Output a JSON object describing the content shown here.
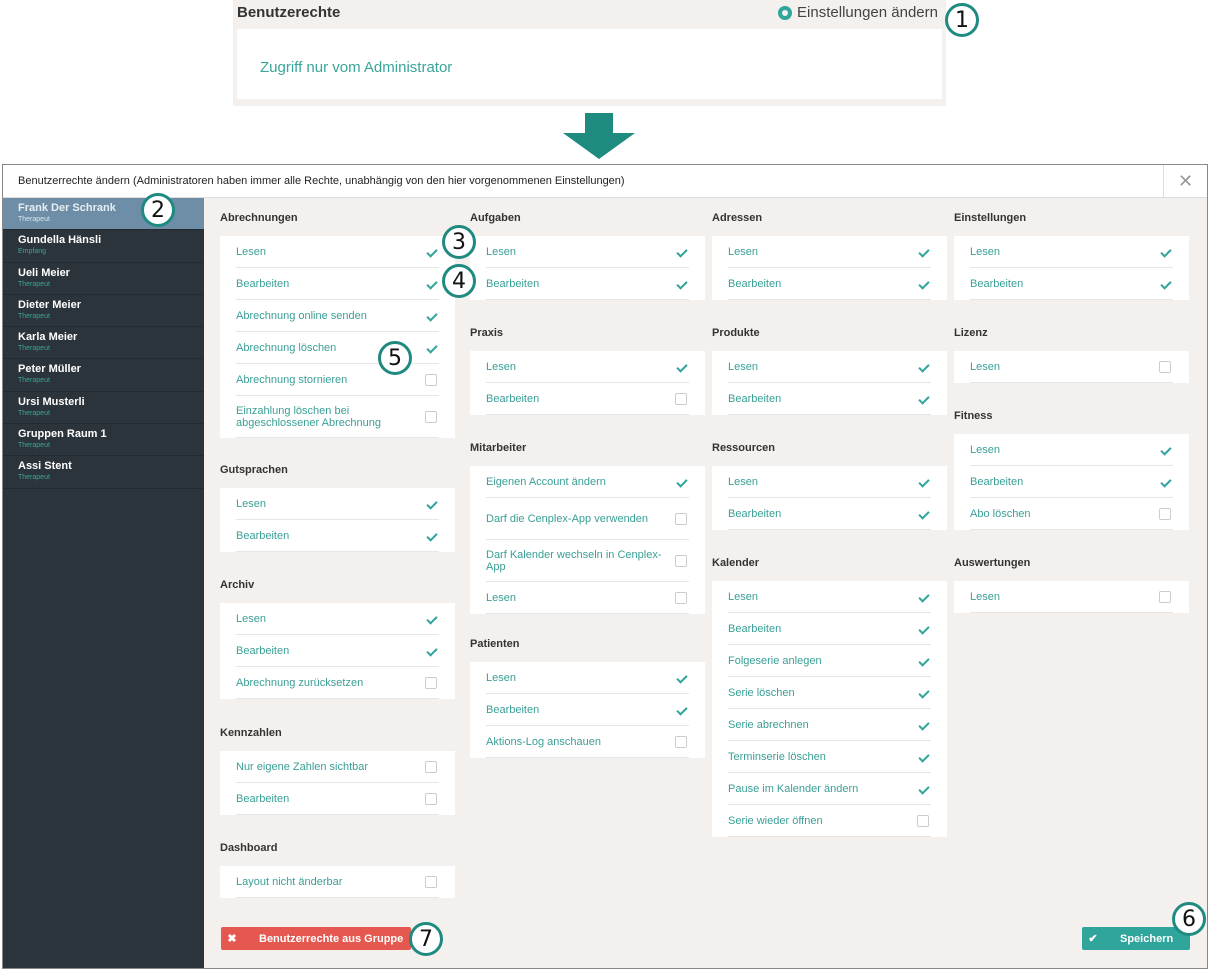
{
  "top": {
    "title": "Benutzerechte",
    "settings_label": "Einstellungen ändern",
    "access_text": "Zugriff nur vom Administrator"
  },
  "modal": {
    "title": "Benutzerrechte ändern (Administratoren haben immer alle Rechte, unabhängig von den hier vorgenommenen Einstellungen)",
    "close": "✕"
  },
  "users": [
    {
      "name": "Frank Der Schrank",
      "role": "Therapeut",
      "active": true
    },
    {
      "name": "Gundella Hänsli",
      "role": "Empfang"
    },
    {
      "name": "Ueli  Meier",
      "role": "Therapeut"
    },
    {
      "name": "Dieter Meier",
      "role": "Therapeut"
    },
    {
      "name": "Karla Meier",
      "role": "Therapeut"
    },
    {
      "name": "Peter Müller",
      "role": "Therapeut"
    },
    {
      "name": "Ursi Musterli",
      "role": "Therapeut"
    },
    {
      "name": "Gruppen Raum 1",
      "role": "Therapeut"
    },
    {
      "name": "Assi Stent",
      "role": "Therapeut"
    }
  ],
  "groups": [
    {
      "title": "Abrechnungen",
      "items": [
        {
          "label": "Lesen",
          "checked": true
        },
        {
          "label": "Bearbeiten",
          "checked": true
        },
        {
          "label": "Abrechnung online senden",
          "checked": true
        },
        {
          "label": "Abrechnung löschen",
          "checked": true
        },
        {
          "label": "Abrechnung stornieren",
          "checked": false
        },
        {
          "label": "Einzahlung löschen bei abgeschlossener Abrechnung",
          "checked": false
        }
      ]
    },
    {
      "title": "Gutsprachen",
      "items": [
        {
          "label": "Lesen",
          "checked": true
        },
        {
          "label": "Bearbeiten",
          "checked": true
        }
      ]
    },
    {
      "title": "Archiv",
      "items": [
        {
          "label": "Lesen",
          "checked": true
        },
        {
          "label": "Bearbeiten",
          "checked": true
        },
        {
          "label": "Abrechnung zurücksetzen",
          "checked": false
        }
      ]
    },
    {
      "title": "Kennzahlen",
      "items": [
        {
          "label": "Nur eigene Zahlen sichtbar",
          "checked": false
        },
        {
          "label": "Bearbeiten",
          "checked": false
        }
      ]
    },
    {
      "title": "Dashboard",
      "items": [
        {
          "label": "Layout nicht änderbar",
          "checked": false
        }
      ]
    },
    {
      "title": "Aufgaben",
      "items": [
        {
          "label": "Lesen",
          "checked": true
        },
        {
          "label": "Bearbeiten",
          "checked": true
        }
      ]
    },
    {
      "title": "Praxis",
      "items": [
        {
          "label": "Lesen",
          "checked": true
        },
        {
          "label": "Bearbeiten",
          "checked": false
        }
      ]
    },
    {
      "title": "Mitarbeiter",
      "items": [
        {
          "label": "Eigenen Account ändern",
          "checked": true
        },
        {
          "label": "Darf die Cenplex-App verwenden",
          "checked": false
        },
        {
          "label": "Darf Kalender wechseln in Cenplex-App",
          "checked": false
        },
        {
          "label": "Lesen",
          "checked": false
        }
      ]
    },
    {
      "title": "Patienten",
      "items": [
        {
          "label": "Lesen",
          "checked": true
        },
        {
          "label": "Bearbeiten",
          "checked": true
        },
        {
          "label": "Aktions-Log anschauen",
          "checked": false
        }
      ]
    },
    {
      "title": "Adressen",
      "items": [
        {
          "label": "Lesen",
          "checked": true
        },
        {
          "label": "Bearbeiten",
          "checked": true
        }
      ]
    },
    {
      "title": "Produkte",
      "items": [
        {
          "label": "Lesen",
          "checked": true
        },
        {
          "label": "Bearbeiten",
          "checked": true
        }
      ]
    },
    {
      "title": "Ressourcen",
      "items": [
        {
          "label": "Lesen",
          "checked": true
        },
        {
          "label": "Bearbeiten",
          "checked": true
        }
      ]
    },
    {
      "title": "Kalender",
      "items": [
        {
          "label": "Lesen",
          "checked": true
        },
        {
          "label": "Bearbeiten",
          "checked": true
        },
        {
          "label": "Folgeserie anlegen",
          "checked": true
        },
        {
          "label": "Serie löschen",
          "checked": true
        },
        {
          "label": "Serie abrechnen",
          "checked": true
        },
        {
          "label": "Terminserie löschen",
          "checked": true
        },
        {
          "label": "Pause im Kalender ändern",
          "checked": true
        },
        {
          "label": "Serie wieder öffnen",
          "checked": false
        }
      ]
    },
    {
      "title": "Einstellungen",
      "items": [
        {
          "label": "Lesen",
          "checked": true
        },
        {
          "label": "Bearbeiten",
          "checked": true
        }
      ]
    },
    {
      "title": "Lizenz",
      "items": [
        {
          "label": "Lesen",
          "checked": false
        }
      ]
    },
    {
      "title": "Fitness",
      "items": [
        {
          "label": "Lesen",
          "checked": true
        },
        {
          "label": "Bearbeiten",
          "checked": true
        },
        {
          "label": "Abo löschen",
          "checked": false
        }
      ]
    },
    {
      "title": "Auswertungen",
      "items": [
        {
          "label": "Lesen",
          "checked": false
        }
      ]
    }
  ],
  "buttons": {
    "remove_group": "Benutzerrechte aus Gruppe",
    "remove_icon": "✖",
    "save": "Speichern",
    "save_icon": "✔"
  },
  "badges": [
    "1",
    "2",
    "3",
    "4",
    "5",
    "6",
    "7"
  ],
  "colors": {
    "accent": "#2fa59b",
    "sidebar": "#2c343b",
    "danger": "#e5584f"
  }
}
